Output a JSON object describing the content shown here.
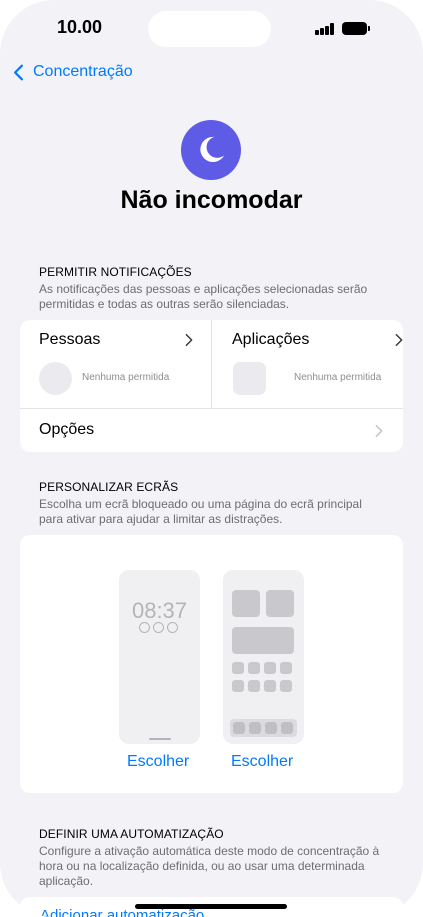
{
  "status_bar": {
    "time": "10.00"
  },
  "nav": {
    "back_label": "Concentração"
  },
  "header": {
    "title": "Não incomodar",
    "icon": "moon-icon",
    "accent_color": "#5e5ce6"
  },
  "allow_notifications": {
    "heading": "PERMITIR NOTIFICAÇÕES",
    "description": "As notificações das pessoas e aplicações selecionadas serão permitidas e todas as outras serão silenciadas.",
    "people": {
      "label": "Pessoas",
      "status": "Nenhuma permitida"
    },
    "apps": {
      "label": "Aplicações",
      "status": "Nenhuma permitida"
    },
    "options_label": "Opções"
  },
  "customize_screens": {
    "heading": "PERSONALIZAR ECRÃS",
    "description": "Escolha um ecrã bloqueado ou uma página do ecrã principal para ativar para ajudar a limitar as distrações.",
    "lock_screen_time": "08:37",
    "lock_choose_label": "Escolher",
    "home_choose_label": "Escolher"
  },
  "automation": {
    "heading": "DEFINIR UMA AUTOMATIZAÇÃO",
    "description": "Configure a ativação automática deste modo de concentração à hora ou na localização definida, ou ao usar uma determinada aplicação.",
    "add_label": "Adicionar automatização"
  },
  "colors": {
    "background": "#f2f2f7",
    "link": "#007aff"
  }
}
